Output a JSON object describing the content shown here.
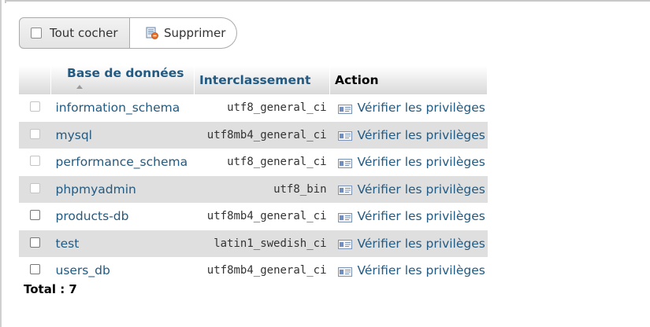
{
  "toolbar": {
    "check_all_label": "Tout cocher",
    "delete_label": "Supprimer"
  },
  "table": {
    "headers": {
      "database": "Base de données",
      "collation": "Interclassement",
      "action": "Action"
    },
    "rows": [
      {
        "name": "information_schema",
        "collation": "utf8_general_ci",
        "action": "Vérifier les privilèges",
        "checkbox_enabled": false
      },
      {
        "name": "mysql",
        "collation": "utf8mb4_general_ci",
        "action": "Vérifier les privilèges",
        "checkbox_enabled": false
      },
      {
        "name": "performance_schema",
        "collation": "utf8_general_ci",
        "action": "Vérifier les privilèges",
        "checkbox_enabled": false
      },
      {
        "name": "phpmyadmin",
        "collation": "utf8_bin",
        "action": "Vérifier les privilèges",
        "checkbox_enabled": false
      },
      {
        "name": "products-db",
        "collation": "utf8mb4_general_ci",
        "action": "Vérifier les privilèges",
        "checkbox_enabled": true
      },
      {
        "name": "test",
        "collation": "latin1_swedish_ci",
        "action": "Vérifier les privilèges",
        "checkbox_enabled": true
      },
      {
        "name": "users_db",
        "collation": "utf8mb4_general_ci",
        "action": "Vérifier les privilèges",
        "checkbox_enabled": true
      }
    ]
  },
  "total_label": "Total : 7",
  "icons": {
    "delete": "delete-icon",
    "privileges": "privileges-icon",
    "sort": "sort-ascending-icon"
  },
  "colors": {
    "link": "#235a81",
    "row_alt": "#dfdfdf",
    "header_gradient_bottom": "#d9d9d9"
  }
}
